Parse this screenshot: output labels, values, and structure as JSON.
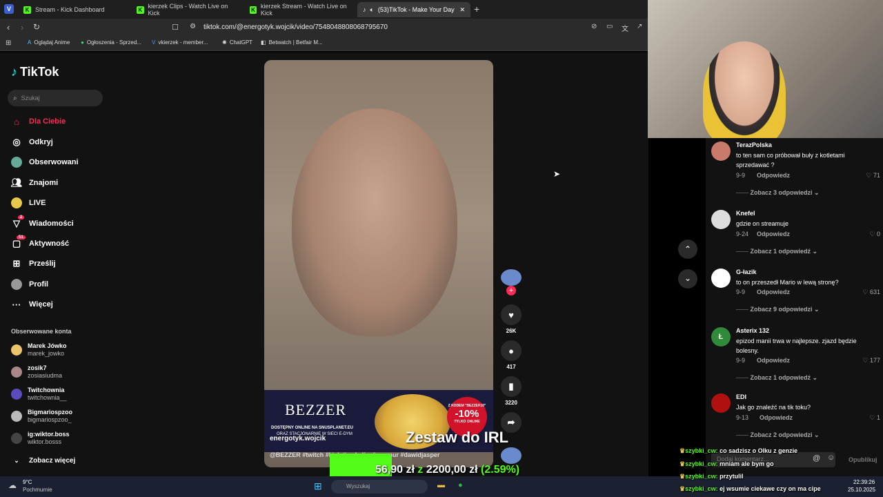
{
  "browser": {
    "tabs": [
      {
        "title": "Stream - Kick Dashboard"
      },
      {
        "title": "kierzek Clips - Watch Live on Kick"
      },
      {
        "title": "kierzek Stream - Watch Live on Kick"
      },
      {
        "title": "(53)TikTok - Make Your Day"
      }
    ],
    "url": "tiktok.com/@energotyk.wojcik/video/7548048808068795670",
    "bookmarks": [
      "Oglądaj Anime",
      "Ogłoszenia - Sprzed...",
      "vkierzek - member...",
      "ChatGPT",
      "Betwatch | Betfair M..."
    ]
  },
  "tiktok": {
    "logo": "TikTok",
    "search_placeholder": "Szukaj",
    "nav": [
      {
        "label": "Dla Ciebie",
        "icon": "home-icon",
        "active": true
      },
      {
        "label": "Odkryj",
        "icon": "compass-icon"
      },
      {
        "label": "Obserwowani",
        "icon": "following-icon"
      },
      {
        "label": "Znajomi",
        "icon": "friends-icon"
      },
      {
        "label": "LIVE",
        "icon": "live-icon"
      },
      {
        "label": "Wiadomości",
        "icon": "messages-icon",
        "badge": "2"
      },
      {
        "label": "Aktywność",
        "icon": "activity-icon",
        "badge": "51"
      },
      {
        "label": "Prześlij",
        "icon": "upload-icon"
      },
      {
        "label": "Profil",
        "icon": "profile-icon"
      },
      {
        "label": "Więcej",
        "icon": "more-icon"
      }
    ],
    "followed_title": "Obserwowane konta",
    "followed": [
      {
        "name": "Marek Jówko",
        "handle": "marek_jowko"
      },
      {
        "name": "zosik7",
        "handle": "zosiasiudma"
      },
      {
        "name": "Twitchownia",
        "handle": "twitchownia__"
      },
      {
        "name": "Bigmariospzoo",
        "handle": "bigmariospzoo_"
      },
      {
        "name": "ig:wiktor.boss",
        "handle": "wiktor.bosss"
      }
    ],
    "see_more": "Zobacz więcej",
    "video": {
      "author": "energotyk.wojcik",
      "caption": "@BEZZER #twitch #kick #makaliw #marmur #dawidjasper",
      "ad_brand": "BEZZER",
      "ad_line1": "DOSTĘPNY ONLINE NA SNUSPLANET.EU",
      "ad_line2": "ORAZ STACJONARNIE W SIECI E-DYM",
      "ad_badge_top": "Z KODEM \"BEZZER10\"",
      "ad_badge_main": "-10%",
      "ad_badge_bottom": "TYLKO ONLINE",
      "likes": "26K",
      "comments": "417",
      "saves": "3220"
    },
    "comments": [
      {
        "user": "TerazPolska",
        "text": "to ten sam co próbował buły z kotletami sprzedawać ?",
        "date": "9-9",
        "likes": "71",
        "more": "Zobacz 3 odpowiedzi"
      },
      {
        "user": "Knefel",
        "text": "gdzie on streamuje",
        "date": "9-24",
        "likes": "0",
        "more": "Zobacz 1 odpowiedź"
      },
      {
        "user": "G-łazik",
        "text": "to on przeszedł Mario w lewą stronę?",
        "date": "9-9",
        "likes": "631",
        "more": "Zobacz 9 odpowiedzi"
      },
      {
        "user": "Asterix 132",
        "text": "epizod manii trwa w najlepsze. zjazd będzie bolesny.",
        "date": "9-9",
        "likes": "177",
        "more": "Zobacz 1 odpowiedź",
        "avatar_letter": "Ł"
      },
      {
        "user": "EDI",
        "text": "Jak go znaleźć na tik toku?",
        "date": "9-13",
        "likes": "1",
        "more": "Zobacz 2 odpowiedzi"
      }
    ],
    "reply_label": "Odpowiedz",
    "comment_placeholder": "Dodaj komentarz...",
    "publish_label": "Opublikuj"
  },
  "overlay": {
    "title": "Zestaw do IRL",
    "progress_text_a": "56,90 zł",
    "progress_text_z": "z",
    "progress_text_b": "2200,00 zł",
    "progress_pct": "(2.59%)",
    "chat": [
      {
        "user": "szybki_cw:",
        "msg": "co sadzisz o Olku z genzie"
      },
      {
        "user": "szybki_cw:",
        "msg": "mniam ale bym go"
      },
      {
        "user": "szybki_cw:",
        "msg": "przytulil"
      },
      {
        "user": "szybki_cw:",
        "msg": "ej wsumie ciekawe czy on ma cipe"
      }
    ]
  },
  "taskbar": {
    "temp": "9°C",
    "weather": "Pochmurnie",
    "search": "Wyszukaj",
    "time": "22:39:26",
    "date": "25.10.2025"
  }
}
